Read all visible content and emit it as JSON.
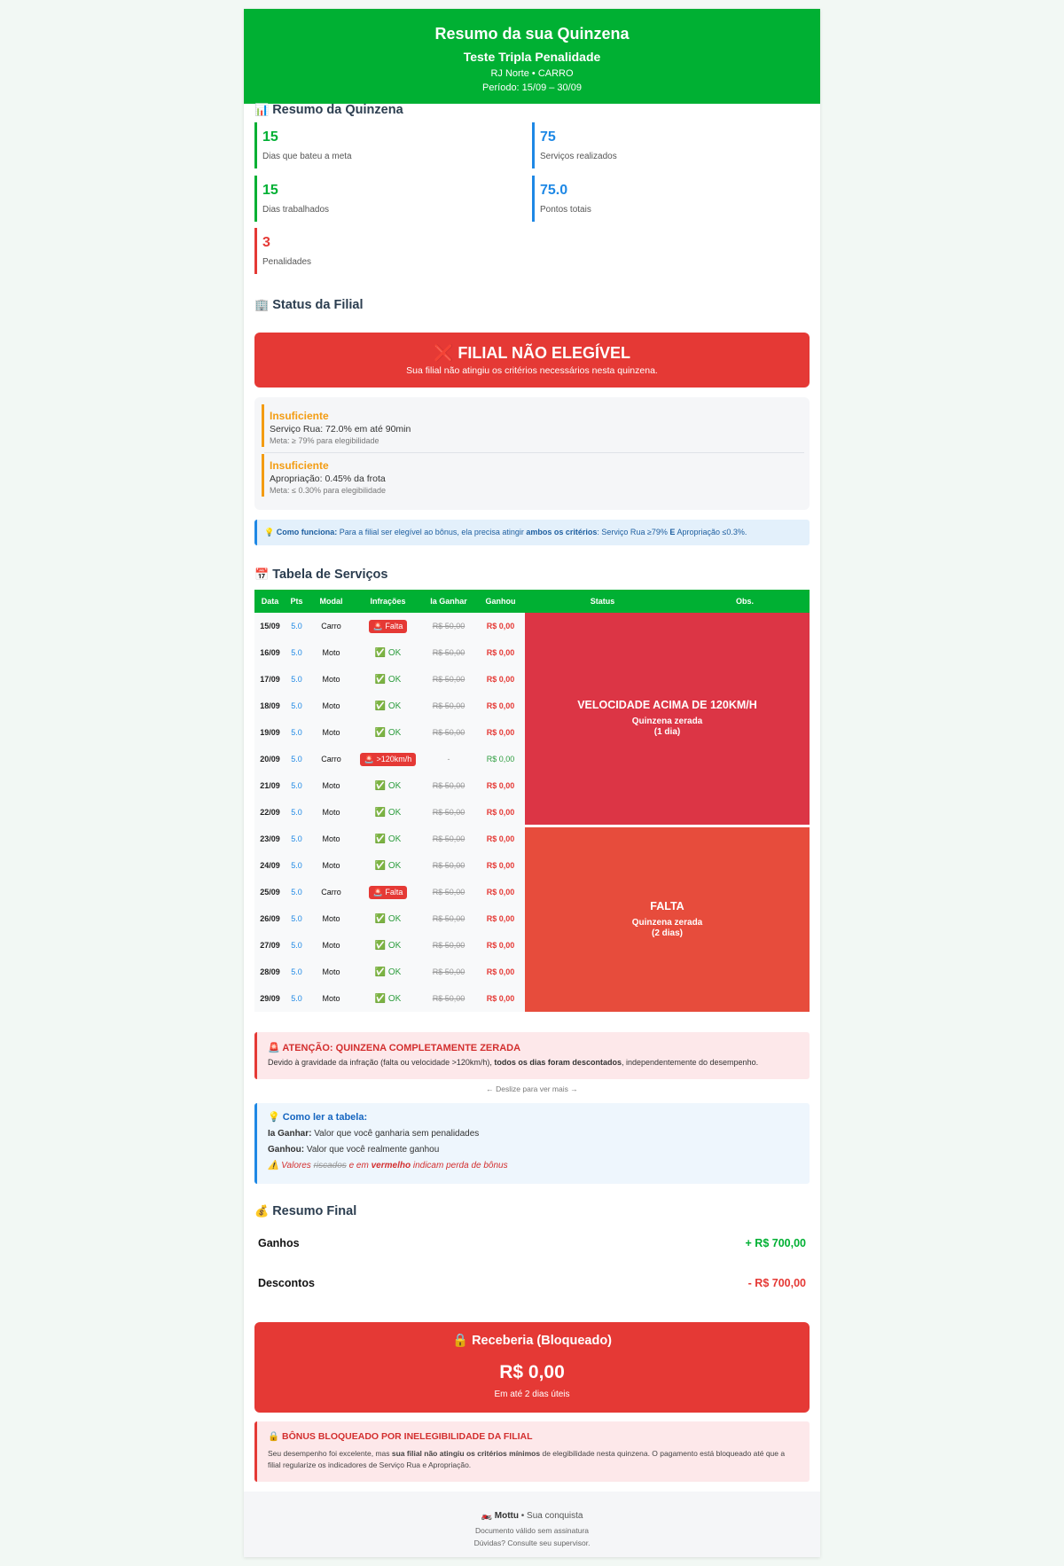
{
  "header": {
    "title": "Resumo da sua Quinzena",
    "name": "Teste Tripla Penalidade",
    "subtitle": "RJ Norte • CARRO",
    "period": "Período: 15/09 – 30/09"
  },
  "summary": {
    "title": "Resumo da Quinzena",
    "icon": "📊",
    "stats": [
      {
        "value": "15",
        "label": "Dias que bateu a meta"
      },
      {
        "value": "75",
        "label": "Serviços realizados"
      },
      {
        "value": "15",
        "label": "Dias trabalhados"
      },
      {
        "value": "75.0",
        "label": "Pontos totais"
      },
      {
        "value": "3",
        "label": "Penalidades"
      }
    ]
  },
  "branch": {
    "title": "Status da Filial",
    "icon": "🏢",
    "banner_icon": "❌",
    "banner_title": "FILIAL NÃO ELEGÍVEL",
    "banner_text": "Sua filial não atingiu os critérios necessários nesta quinzena.",
    "criteria": [
      {
        "status": "Insuficiente",
        "detail": "Serviço Rua: 72.0% em até 90min",
        "goal": "Meta: ≥ 79% para elegibilidade"
      },
      {
        "status": "Insuficiente",
        "detail": "Apropriação: 0.45% da frota",
        "goal": "Meta: ≤ 0.30% para elegibilidade"
      }
    ],
    "info_icon": "💡",
    "info_label": "Como funciona:",
    "info_text_1": "Para a filial ser elegível ao bônus, ela precisa atingir",
    "info_bold": "ambos os critérios",
    "info_text_2": ": Serviço Rua ≥79%",
    "info_e": "E",
    "info_text_3": "Apropriação ≤0.3%."
  },
  "services": {
    "title": "Tabela de Serviços",
    "icon": "📅",
    "columns": [
      "Data",
      "Pts",
      "Modal",
      "Infrações",
      "Ia Ganhar",
      "Ganhou",
      "Status",
      "Obs."
    ],
    "rows": [
      {
        "date": "15/09",
        "pts": "5.0",
        "modal": "Carro",
        "inf": "🚨 Falta",
        "inf_type": "badge",
        "iag": "R$ 50,00",
        "gan": "R$ 0,00"
      },
      {
        "date": "16/09",
        "pts": "5.0",
        "modal": "Moto",
        "inf": "✅ OK",
        "inf_type": "ok",
        "iag": "R$ 50,00",
        "gan": "R$ 0,00"
      },
      {
        "date": "17/09",
        "pts": "5.0",
        "modal": "Moto",
        "inf": "✅ OK",
        "inf_type": "ok",
        "iag": "R$ 50,00",
        "gan": "R$ 0,00"
      },
      {
        "date": "18/09",
        "pts": "5.0",
        "modal": "Moto",
        "inf": "✅ OK",
        "inf_type": "ok",
        "iag": "R$ 50,00",
        "gan": "R$ 0,00"
      },
      {
        "date": "19/09",
        "pts": "5.0",
        "modal": "Moto",
        "inf": "✅ OK",
        "inf_type": "ok",
        "iag": "R$ 50,00",
        "gan": "R$ 0,00"
      },
      {
        "date": "20/09",
        "pts": "5.0",
        "modal": "Carro",
        "inf": "🚨 >120km/h",
        "inf_type": "badge",
        "iag": "-",
        "gan": "R$ 0,00"
      },
      {
        "date": "21/09",
        "pts": "5.0",
        "modal": "Moto",
        "inf": "✅ OK",
        "inf_type": "ok",
        "iag": "R$ 50,00",
        "gan": "R$ 0,00"
      },
      {
        "date": "22/09",
        "pts": "5.0",
        "modal": "Moto",
        "inf": "✅ OK",
        "inf_type": "ok",
        "iag": "R$ 50,00",
        "gan": "R$ 0,00"
      },
      {
        "date": "23/09",
        "pts": "5.0",
        "modal": "Moto",
        "inf": "✅ OK",
        "inf_type": "ok",
        "iag": "R$ 50,00",
        "gan": "R$ 0,00"
      },
      {
        "date": "24/09",
        "pts": "5.0",
        "modal": "Moto",
        "inf": "✅ OK",
        "inf_type": "ok",
        "iag": "R$ 50,00",
        "gan": "R$ 0,00"
      },
      {
        "date": "25/09",
        "pts": "5.0",
        "modal": "Carro",
        "inf": "🚨 Falta",
        "inf_type": "badge",
        "iag": "R$ 50,00",
        "gan": "R$ 0,00"
      },
      {
        "date": "26/09",
        "pts": "5.0",
        "modal": "Moto",
        "inf": "✅ OK",
        "inf_type": "ok",
        "iag": "R$ 50,00",
        "gan": "R$ 0,00"
      },
      {
        "date": "27/09",
        "pts": "5.0",
        "modal": "Moto",
        "inf": "✅ OK",
        "inf_type": "ok",
        "iag": "R$ 50,00",
        "gan": "R$ 0,00"
      },
      {
        "date": "28/09",
        "pts": "5.0",
        "modal": "Moto",
        "inf": "✅ OK",
        "inf_type": "ok",
        "iag": "R$ 50,00",
        "gan": "R$ 0,00"
      },
      {
        "date": "29/09",
        "pts": "5.0",
        "modal": "Moto",
        "inf": "✅ OK",
        "inf_type": "ok",
        "iag": "R$ 50,00",
        "gan": "R$ 0,00"
      }
    ],
    "status_velocidade": {
      "title": "VELOCIDADE ACIMA DE 120KM/H",
      "sub1": "Quinzena zerada",
      "sub2": "(1 dia)"
    },
    "status_falta": {
      "title": "FALTA",
      "sub1": "Quinzena zerada",
      "sub2": "(2 dias)"
    }
  },
  "alert": {
    "icon": "🚨",
    "title": "ATENÇÃO: QUINZENA COMPLETAMENTE ZERADA",
    "text_1": "Devido à gravidade da infração (falta ou velocidade >120km/h),",
    "text_bold": "todos os dias foram descontados",
    "text_2": ", independentemente do desempenho."
  },
  "swipe_hint": "← Deslize para ver mais →",
  "howto": {
    "icon": "💡",
    "title": "Como ler a tabela:",
    "line1_label": "Ia Ganhar:",
    "line1_text": "Valor que você ganharia sem penalidades",
    "line2_label": "Ganhou:",
    "line2_text": "Valor que você realmente ganhou",
    "warn_icon": "⚠️",
    "warn_1": "Valores",
    "warn_strike": "riscados",
    "warn_2": "e em",
    "warn_bold": "vermelho",
    "warn_3": "indicam perda de bônus"
  },
  "final": {
    "title": "Resumo Final",
    "icon": "💰",
    "gains_label": "Ganhos",
    "gains_value": "+ R$ 700,00",
    "discount_label": "Descontos",
    "discount_value": "- R$ 700,00"
  },
  "receive": {
    "icon": "🔒",
    "title": "Receberia (Bloqueado)",
    "amount": "R$ 0,00",
    "note": "Em até 2 dias úteis"
  },
  "blocked": {
    "icon": "🔒",
    "title": "BÔNUS BLOQUEADO POR INELEGIBILIDADE DA FILIAL",
    "text_1": "Seu desempenho foi excelente, mas",
    "text_bold": "sua filial não atingiu os critérios mínimos",
    "text_2": "de elegibilidade nesta quinzena. O pagamento está bloqueado até que a filial regularize os indicadores de Serviço Rua e Apropriação."
  },
  "footer": {
    "icon": "🏍️",
    "brand": "Mottu",
    "tagline": "• Sua conquista",
    "line2": "Documento válido sem assinatura",
    "line3": "Dúvidas? Consulte seu supervisor."
  },
  "colors": {
    "brand_green": "#00b033",
    "danger_red": "#e53935",
    "status_velocidade": "#dc3545",
    "status_falta": "#e74c3c",
    "info_blue": "#1e88e5",
    "warning_orange": "#f39c12"
  }
}
